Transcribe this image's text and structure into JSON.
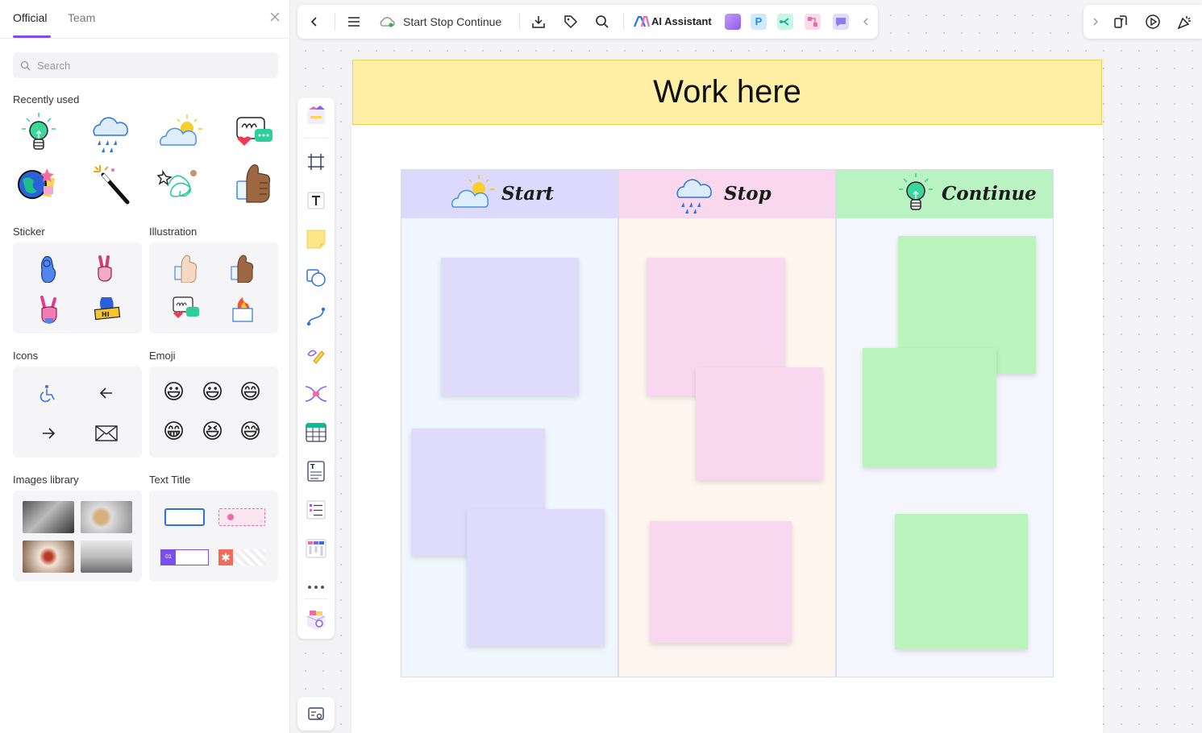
{
  "left_panel": {
    "tabs": [
      {
        "label": "Official"
      },
      {
        "label": "Team"
      }
    ],
    "search": {
      "placeholder": "Search"
    },
    "sections": {
      "recently_used": "Recently used",
      "sticker": "Sticker",
      "illustration": "Illustration",
      "icons": "Icons",
      "emoji": "Emoji",
      "images_library": "Images library",
      "text_title": "Text Title"
    },
    "recent_items": [
      "lightbulb-sticker",
      "rain-cloud-sticker",
      "sun-cloud-sticker",
      "chat-heart-sticker",
      "globe-sticker",
      "magic-wand-sticker",
      "scribble-sticker",
      "thumbs-up-sticker"
    ],
    "emoji": [
      "😃",
      "😃",
      "😄",
      "😁",
      "😆",
      "😅"
    ],
    "text_title_badge": "01"
  },
  "topbar": {
    "title": "Start Stop Continue",
    "ai_label": "AI Assistant",
    "app_badges": [
      {
        "name": "image-ai",
        "color": "#b07cf0"
      },
      {
        "name": "p-app",
        "color": "#3aa6f5",
        "letter": "P"
      },
      {
        "name": "mindmap-app",
        "color": "#1fcfb0"
      },
      {
        "name": "flow-app",
        "color": "#f06aa8"
      },
      {
        "name": "chat-app",
        "color": "#8f7cf0"
      }
    ]
  },
  "board": {
    "banner": "Work here",
    "columns": [
      {
        "label": "Start",
        "head_color": "#ddd9fc",
        "body_color": "#f0f6fd",
        "note_color": "#dfdcfb"
      },
      {
        "label": "Stop",
        "head_color": "#f9d8ee",
        "body_color": "#fdf5ee",
        "note_color": "#f8d8ef"
      },
      {
        "label": "Continue",
        "head_color": "#b9f3c2",
        "body_color": "#f5f5fd",
        "note_color": "#b9f4bd"
      }
    ]
  },
  "colors": {
    "accent": "#7b4ef0",
    "banner_bg": "#fff0a6",
    "banner_border": "#eccc52"
  }
}
